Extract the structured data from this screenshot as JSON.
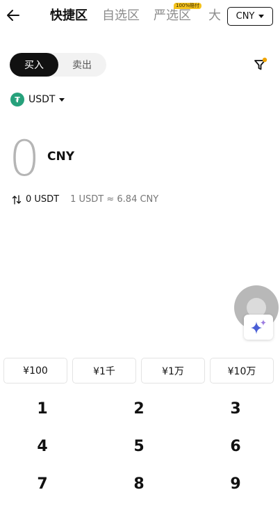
{
  "header": {
    "tabs": [
      {
        "label": "快捷区",
        "active": true
      },
      {
        "label": "自选区",
        "active": false
      },
      {
        "label": "严选区",
        "active": false
      },
      {
        "label": "大",
        "active": false
      }
    ],
    "strict_badge": "100%赔付",
    "currency": "CNY"
  },
  "trade": {
    "buy_label": "买入",
    "sell_label": "卖出",
    "selected": "buy"
  },
  "asset": {
    "symbol": "USDT",
    "icon": "tether-icon"
  },
  "amount": {
    "value": "0",
    "unit": "CNY"
  },
  "conversion": {
    "crypto_amount": "0 USDT",
    "rate": "1 USDT ≈ 6.84 CNY"
  },
  "quick_amounts": [
    "¥100",
    "¥1千",
    "¥1万",
    "¥10万"
  ],
  "keypad": [
    "1",
    "2",
    "3",
    "4",
    "5",
    "6",
    "7",
    "8",
    "9"
  ],
  "colors": {
    "accent": "#111111",
    "badge": "#f4c21c",
    "tether": "#26a17b",
    "filter_dot": "#f0a500",
    "sparkle": "#4a5fd6"
  }
}
